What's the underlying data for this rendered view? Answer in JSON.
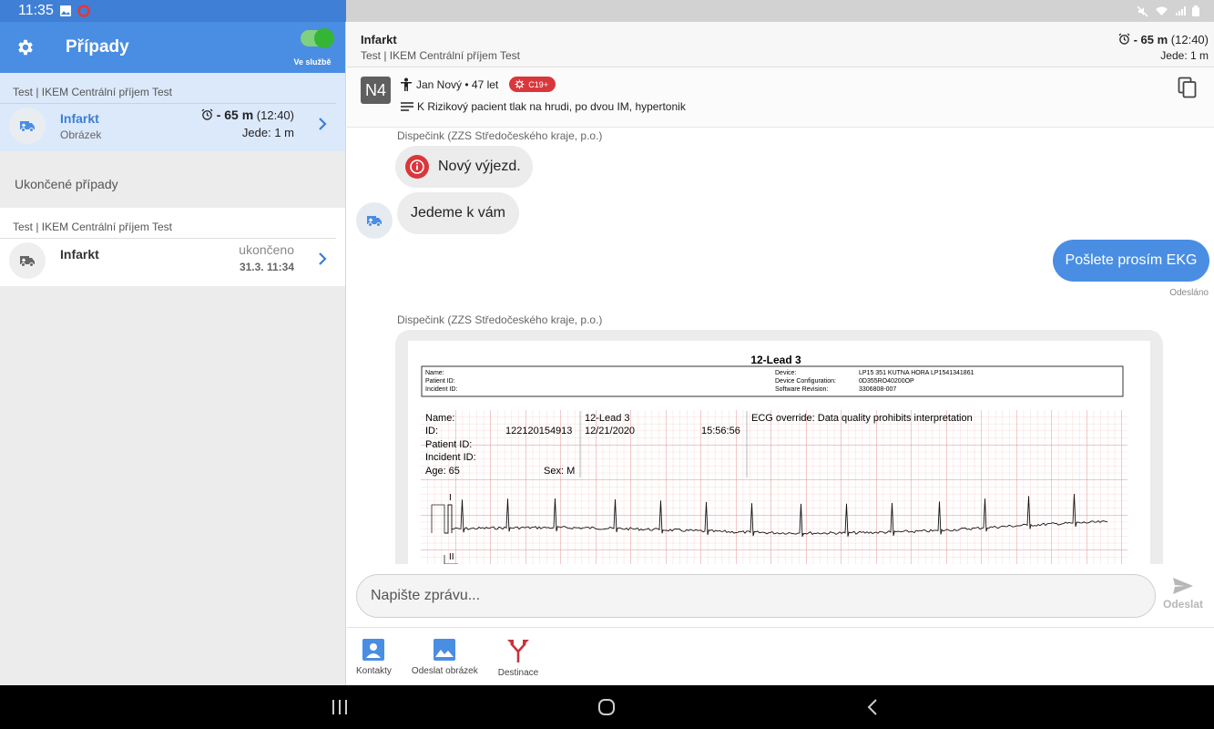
{
  "status": {
    "time": "11:35"
  },
  "sidebar": {
    "title": "Případy",
    "toggle_label": "Ve službě",
    "active_case": {
      "org": "Test | IKEM Centrální příjem Test",
      "name": "Infarkt",
      "sub": "Obrázek",
      "eta_bold": "- 65 m",
      "eta_time": "(12:40)",
      "going": "Jede: 1 m"
    },
    "finished_title": "Ukončené případy",
    "finished_case": {
      "org": "Test | IKEM Centrální příjem Test",
      "name": "Infarkt",
      "status": "ukončeno",
      "date": "31.3. 11:34"
    }
  },
  "header": {
    "title": "Infarkt",
    "subtitle": "Test | IKEM Centrální příjem Test",
    "eta_bold": "- 65 m",
    "eta_time": "(12:40)",
    "going": "Jede: 1 m"
  },
  "patient": {
    "badge": "N4",
    "name_age": "Jan Nový • 47 let",
    "covid_badge": "C19+",
    "note": "K Rizikový pacient tlak na hrudi, po dvou IM, hypertonik"
  },
  "messages": {
    "sender1": "Dispečink (ZZS Středočeského kraje, p.o.)",
    "msg1": "Nový výjezd.",
    "msg2": "Jedeme k vám",
    "out1": "Pošlete prosím EKG",
    "sent_label": "Odesláno",
    "sender2": "Dispečink (ZZS Středočeského kraje, p.o.)"
  },
  "ecg": {
    "title": "12-Lead 3",
    "info_left": [
      "Name:",
      "Patient ID:",
      "Incident ID:"
    ],
    "info_mid": [
      "Device:",
      "Device Configuration:",
      "Software Revision:"
    ],
    "info_right": [
      "LP15 351 KUTNA HORA LP1541341861",
      "0D355RO40200OP",
      "3306808-007"
    ],
    "name_label": "Name:",
    "lead_label": "12-Lead 3",
    "override": "ECG override: Data quality prohibits interpretation",
    "id_label": "ID:",
    "id_value": "122120154913",
    "date": "12/21/2020",
    "time": "15:56:56",
    "patient_id_label": "Patient ID:",
    "incident_id_label": "Incident ID:",
    "age": "Age: 65",
    "sex": "Sex: M",
    "lead_I": "I",
    "lead_II": "II"
  },
  "composer": {
    "placeholder": "Napište zprávu...",
    "send_label": "Odeslat"
  },
  "actions": {
    "contacts": "Kontakty",
    "send_image": "Odeslat obrázek",
    "destination": "Destinace"
  },
  "colors": {
    "primary": "#4a8ee3",
    "selected_row": "#dce9fb",
    "toggle_on": "#35b535",
    "alert_red": "#d9373c",
    "destination_red": "#c8333a"
  }
}
